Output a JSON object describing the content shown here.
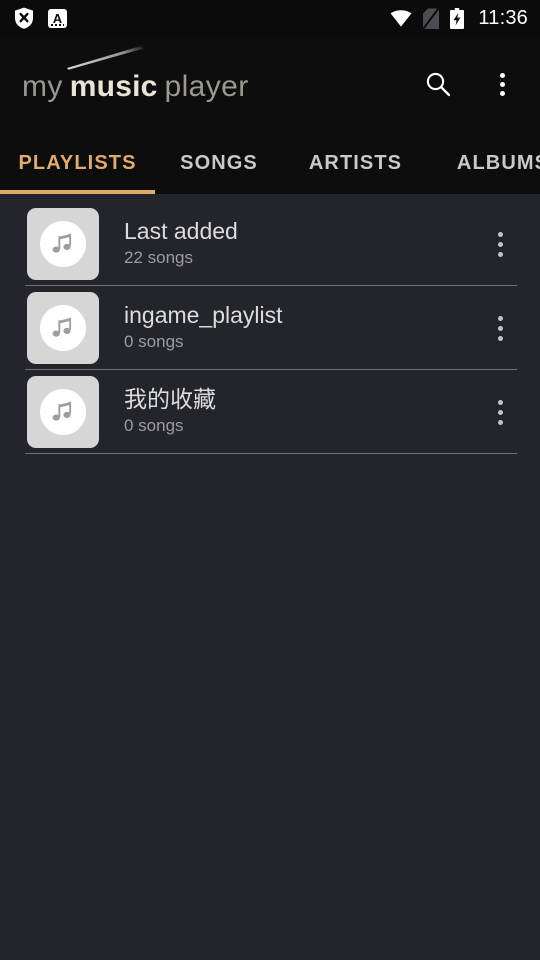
{
  "status_bar": {
    "left_icons": [
      {
        "name": "shield-x-icon",
        "label": "Shield blocked"
      },
      {
        "name": "ime-keyboard-icon",
        "label": "A"
      }
    ],
    "right_icons": [
      {
        "name": "wifi-icon",
        "label": "Wi-Fi"
      },
      {
        "name": "no-sim-card-icon",
        "label": "No SIM"
      },
      {
        "name": "battery-charging-icon",
        "label": "Charging"
      }
    ],
    "time": "11:36"
  },
  "app_bar": {
    "logo": {
      "part1": "my",
      "part2": "music",
      "part3": "player"
    },
    "search_icon": "search-icon",
    "overflow_icon": "more-vert-icon"
  },
  "tabs": [
    {
      "label": "PLAYLISTS",
      "active": true
    },
    {
      "label": "SONGS",
      "active": false
    },
    {
      "label": "ARTISTS",
      "active": false
    },
    {
      "label": "ALBUMS",
      "active": false
    }
  ],
  "playlists": [
    {
      "title": "Last added",
      "subtitle": "22 songs"
    },
    {
      "title": "ingame_playlist",
      "subtitle": "0 songs"
    },
    {
      "title": "我的收藏",
      "subtitle": "0 songs"
    }
  ],
  "colors": {
    "accent": "#e0a863",
    "status_bar_bg": "#0b0b0c",
    "app_bar_bg": "#0d0d0e",
    "content_bg": "#24252b",
    "title_text": "#dcdcdc",
    "subtitle_text": "#9b9ba0",
    "divider": "#6d7078",
    "thumb_bg": "#d6d6d6"
  }
}
